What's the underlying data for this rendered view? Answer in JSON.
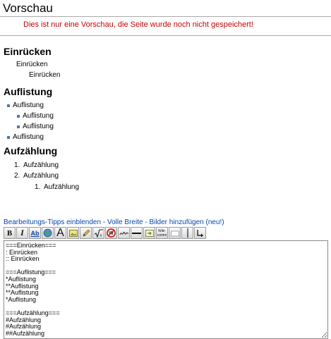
{
  "preview": {
    "title": "Vorschau",
    "note": "Dies ist nur eine Vorschau, die Seite wurde noch nicht gespeichert!"
  },
  "sections": {
    "indent": {
      "heading": "Einrücken",
      "items": [
        "Einrücken",
        "Einrücken"
      ]
    },
    "list": {
      "heading": "Auflistung",
      "items": [
        "Auflistung",
        "Auflistung",
        "Auflistung",
        "Auflistung"
      ]
    },
    "enum": {
      "heading": "Aufzählung",
      "items": [
        {
          "number": "1.",
          "text": "Aufzählung"
        },
        {
          "number": "2.",
          "text": "Aufzählung"
        },
        {
          "number": "1.",
          "text": "Aufzählung"
        }
      ]
    }
  },
  "edit_links": {
    "tips": "Bearbeitungs-Tipps einblenden",
    "full_width": "Volle Breite",
    "images": "Bilder hinzufügen (neu!)",
    "separator": " - "
  },
  "toolbar": {
    "bold": "B",
    "italic": "I",
    "link": "Ab",
    "big_letter": "A",
    "wiki_comment": "Wiki-comm",
    "buttons": [
      "bold-icon",
      "italic-icon",
      "internal-link-icon",
      "globe-link-icon",
      "big-letter-icon",
      "embedded-image-icon",
      "pencil-icon",
      "math-formula-icon",
      "nowiki-icon",
      "signature-icon",
      "horizontal-line-icon",
      "insert-arrow-icon",
      "wiki-comment-icon",
      "blank-icon",
      "pipe-icon",
      "return-arrow-icon"
    ]
  },
  "editor": {
    "content": "===Einrücken===\n: Einrücken\n:: Einrücken\n\n===Auflistung===\n*Auflistung\n**Auflistung\n**Auflistung\n*Auflistung\n\n===Aufzählung===\n#Aufzählung\n#Aufzählung\n##Aufzählung"
  },
  "colors": {
    "link": "#0645ad",
    "warning": "#cc0000",
    "bullet": "#4a7aa8"
  }
}
